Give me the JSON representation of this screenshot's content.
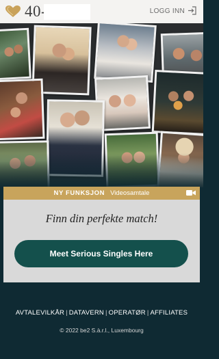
{
  "header": {
    "brand": "40-",
    "login_label": "LOGG INN"
  },
  "collage": {
    "photos": [
      {
        "name": "photo-couple-lake"
      },
      {
        "name": "photo-couple-kiss"
      },
      {
        "name": "photo-couple-embrace"
      },
      {
        "name": "photo-couple-smiling"
      },
      {
        "name": "photo-couple-hug-window"
      },
      {
        "name": "photo-couple-cheek"
      },
      {
        "name": "photo-couple-campfire"
      },
      {
        "name": "photo-couple-suit"
      },
      {
        "name": "photo-couple-selfie"
      },
      {
        "name": "photo-woman-hat"
      },
      {
        "name": "photo-couple-forest"
      }
    ]
  },
  "card": {
    "banner_tag": "NY FUNKSJON",
    "banner_text": "Videosamtale",
    "tagline": "Finn din perfekte match!",
    "cta_label": "Meet Serious Singles Here"
  },
  "footer": {
    "links": [
      "AVTALEVILKÅR",
      "DATAVERN",
      "OPERATØR",
      "AFFILIATES"
    ],
    "copyright": "© 2022 be2 S.à.r.l., Luxembourg"
  },
  "colors": {
    "accent_gold": "#c8a45c",
    "cta_green": "#14504c",
    "background": "#0f2a33"
  }
}
